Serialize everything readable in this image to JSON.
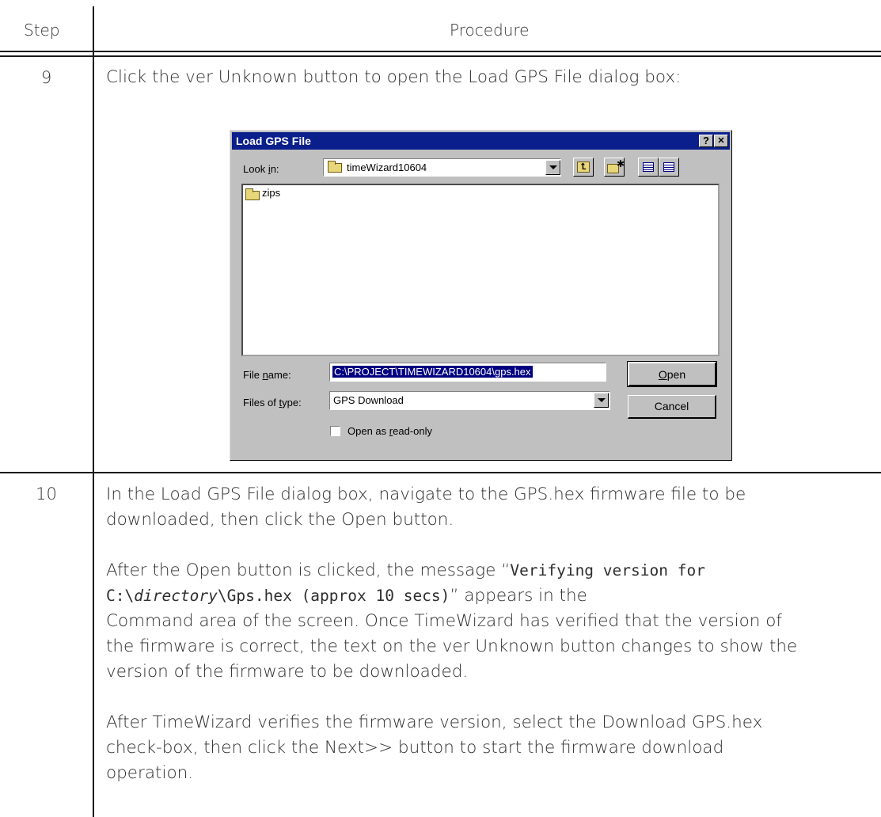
{
  "table": {
    "header_step": "Step",
    "header_procedure": "Procedure"
  },
  "row9": {
    "step": "9",
    "text": "Click the ver Unknown button to open the Load GPS File dialog box:"
  },
  "dialog": {
    "title": "Load GPS File",
    "help_btn": "?",
    "close_btn": "✕",
    "look_in_label": "Look in:",
    "look_in_value": "timeWizard10604",
    "folder_item": "zips",
    "file_name_label": "File name:",
    "file_name_value": "C:\\PROJECT\\TIMEWIZARD10604\\gps.hex",
    "files_of_type_label": "Files of type:",
    "files_of_type_value": "GPS Download",
    "open_button": "Open",
    "cancel_button": "Cancel",
    "readonly_label": "Open as read-only"
  },
  "row10": {
    "step": "10",
    "p1_line1": "In the Load GPS File dialog box, navigate to the GPS.hex firmware file to be",
    "p1_line2": "downloaded, then click the Open button.",
    "p2_line1_a": "After the Open button is clicked, the message “",
    "p2_line1_mono": "Verifying version for",
    "p2_line2_mono_a": "C:\\",
    "p2_line2_mono_ital": "directory",
    "p2_line2_mono_b": "\\Gps.hex (approx 10 secs)",
    "p2_line2_b": "” appears in the",
    "p2_line3": "Command area of the screen. Once TimeWizard has verified that the version of",
    "p2_line4": "the firmware is correct, the text on the ver Unknown button changes to show the",
    "p2_line5": "version of the firmware to be downloaded.",
    "p3_line1": "After TimeWizard verifies the firmware version, select the Download GPS.hex",
    "p3_line2": "check-box, then click the Next>> button to start the firmware download",
    "p3_line3": "operation."
  }
}
